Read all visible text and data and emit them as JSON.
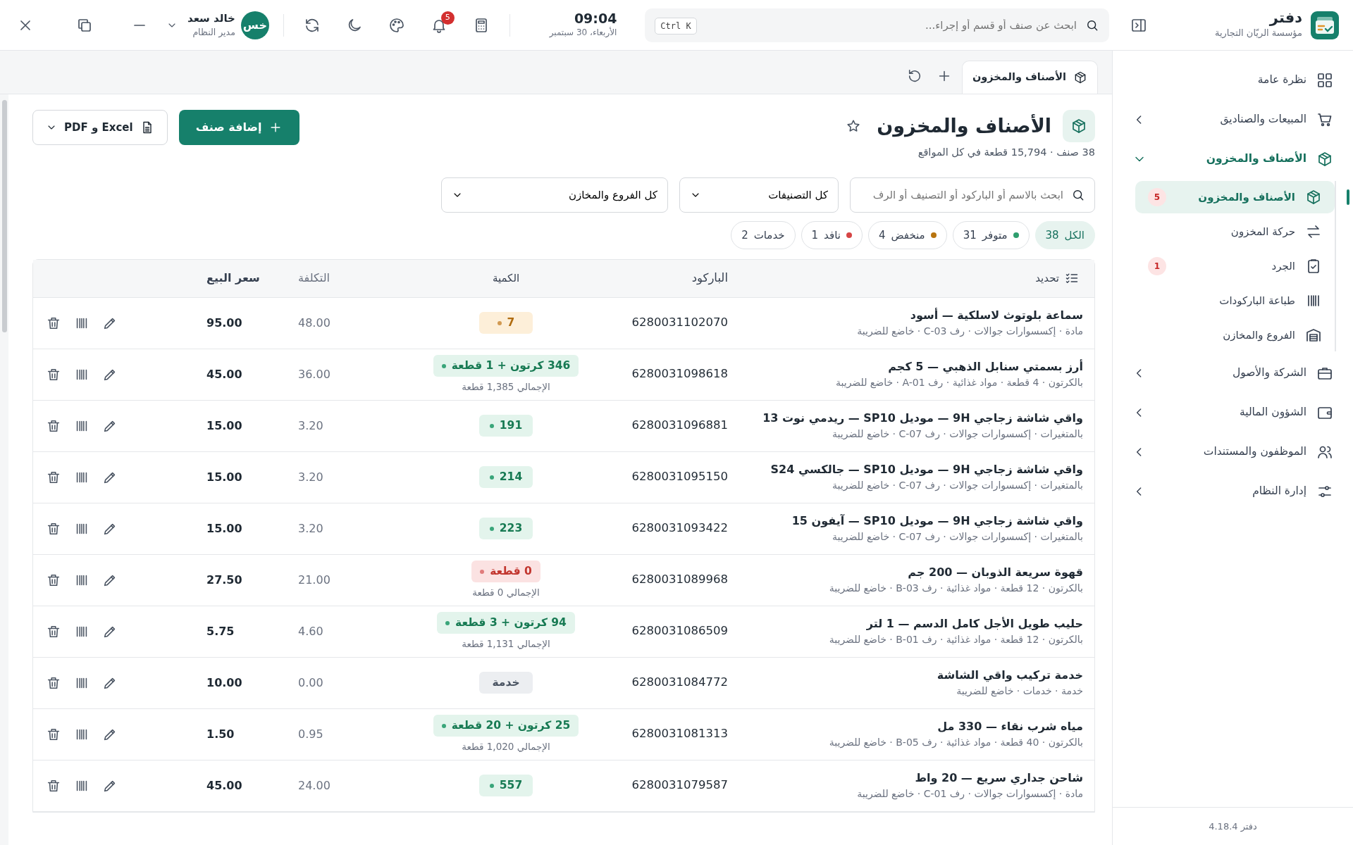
{
  "app": {
    "name": "دفتر",
    "company": "مؤسسة الريّان التجارية"
  },
  "topbar": {
    "search_placeholder": "ابحث عن صنف أو قسم أو إجراء...",
    "shortcut": "Ctrl K",
    "time": "09:04",
    "date": "الأربعاء، 30 سبتمبر",
    "notifications": "5",
    "user": {
      "initials": "خس",
      "name": "خالد سعد",
      "role": "مدير النظام"
    }
  },
  "sidebar": {
    "items": [
      {
        "label": "نظرة عامة"
      },
      {
        "label": "المبيعات والصناديق",
        "expanded": false
      },
      {
        "label": "الأصناف والمخزون",
        "expanded": true,
        "children": [
          {
            "label": "الأصناف والمخزون",
            "selected": true,
            "badge": "5"
          },
          {
            "label": "حركة المخزون",
            "selected": false
          },
          {
            "label": "الجرد",
            "selected": false,
            "badge": "1"
          },
          {
            "label": "طباعة الباركودات",
            "selected": false
          },
          {
            "label": "الفروع والمخازن",
            "selected": false
          }
        ]
      },
      {
        "label": "الشركة والأصول",
        "expanded": false
      },
      {
        "label": "الشؤون المالية",
        "expanded": false
      },
      {
        "label": "الموظفون والمستندات",
        "expanded": false
      },
      {
        "label": "إدارة النظام",
        "expanded": false
      }
    ],
    "version": "دفتر 4.18.4"
  },
  "tabs": [
    {
      "label": "الأصناف والمخزون",
      "selected": true
    }
  ],
  "page": {
    "title": "الأصناف والمخزون",
    "subtitle": "38 صنف · 15,794 قطعة في كل المواقع",
    "add_button": "إضافة صنف",
    "export_button": "Excel و PDF"
  },
  "filters": {
    "search_placeholder": "ابحث بالاسم أو الباركود أو التصنيف أو الرف",
    "category": "كل التصنيفات",
    "branch": "كل الفروع والمخازن"
  },
  "chips": [
    {
      "label": "الكل",
      "count": "38",
      "selected": true
    },
    {
      "label": "متوفر",
      "count": "31",
      "selected": false,
      "color": "#2f9e6e"
    },
    {
      "label": "منخفض",
      "count": "4",
      "selected": false,
      "color": "#b8740f"
    },
    {
      "label": "نافد",
      "count": "1",
      "selected": false,
      "color": "#d64545"
    },
    {
      "label": "خدمات",
      "count": "2",
      "selected": false
    }
  ],
  "table": {
    "columns": [
      "تحديد",
      "الباركود",
      "الكمية",
      "التكلفة",
      "سعر البيع"
    ],
    "rows": [
      {
        "name": "سماعة بلوتوث لاسلكية — أسود",
        "meta": "مادة · إكسسوارات جوالات · رف C-03 · خاضع للضريبة",
        "barcode": "6280031102070",
        "qty": "7",
        "kind": "low",
        "cost": "48.00",
        "price": "95.00"
      },
      {
        "name": "أرز بسمتي سنابل الذهبي — 5 كجم",
        "meta": "بالكرتون · 4 قطعة · مواد غذائية · رف A-01 · خاضع للضريبة",
        "barcode": "6280031098618",
        "qty": "346 كرتون + 1 قطعة",
        "total": "الإجمالي 1,385 قطعة",
        "kind": "ok",
        "cost": "36.00",
        "price": "45.00"
      },
      {
        "name": "واقي شاشة زجاجي 9H — موديل SP10 — ريدمي نوت 13",
        "meta": "بالمتغيرات · إكسسوارات جوالات · رف C-07 · خاضع للضريبة",
        "barcode": "6280031096881",
        "qty": "191",
        "kind": "ok",
        "cost": "3.20",
        "price": "15.00"
      },
      {
        "name": "واقي شاشة زجاجي 9H — موديل SP10 — جالكسي S24",
        "meta": "بالمتغيرات · إكسسوارات جوالات · رف C-07 · خاضع للضريبة",
        "barcode": "6280031095150",
        "qty": "214",
        "kind": "ok",
        "cost": "3.20",
        "price": "15.00"
      },
      {
        "name": "واقي شاشة زجاجي 9H — موديل SP10 — آيفون 15",
        "meta": "بالمتغيرات · إكسسوارات جوالات · رف C-07 · خاضع للضريبة",
        "barcode": "6280031093422",
        "qty": "223",
        "kind": "ok",
        "cost": "3.20",
        "price": "15.00"
      },
      {
        "name": "قهوة سريعة الذوبان — 200 جم",
        "meta": "بالكرتون · 12 قطعة · مواد غذائية · رف B-03 · خاضع للضريبة",
        "barcode": "6280031089968",
        "qty": "0 قطعة",
        "total": "الإجمالي 0 قطعة",
        "kind": "out",
        "cost": "21.00",
        "price": "27.50"
      },
      {
        "name": "حليب طويل الأجل كامل الدسم — 1 لتر",
        "meta": "بالكرتون · 12 قطعة · مواد غذائية · رف B-01 · خاضع للضريبة",
        "barcode": "6280031086509",
        "qty": "94 كرتون + 3 قطعة",
        "total": "الإجمالي 1,131 قطعة",
        "kind": "ok",
        "cost": "4.60",
        "price": "5.75"
      },
      {
        "name": "خدمة تركيب واقي الشاشة",
        "meta": "خدمة · خدمات · خاضع للضريبة",
        "barcode": "6280031084772",
        "qty": "خدمة",
        "kind": "service",
        "cost": "0.00",
        "price": "10.00"
      },
      {
        "name": "مياه شرب نقاء — 330 مل",
        "meta": "بالكرتون · 40 قطعة · مواد غذائية · رف B-05 · خاضع للضريبة",
        "barcode": "6280031081313",
        "qty": "25 كرتون + 20 قطعة",
        "total": "الإجمالي 1,020 قطعة",
        "kind": "ok",
        "cost": "0.95",
        "price": "1.50"
      },
      {
        "name": "شاحن جداري سريع — 20 واط",
        "meta": "مادة · إكسسوارات جوالات · رف C-01 · خاضع للضريبة",
        "barcode": "6280031079587",
        "qty": "557",
        "kind": "ok",
        "cost": "24.00",
        "price": "45.00"
      }
    ]
  }
}
